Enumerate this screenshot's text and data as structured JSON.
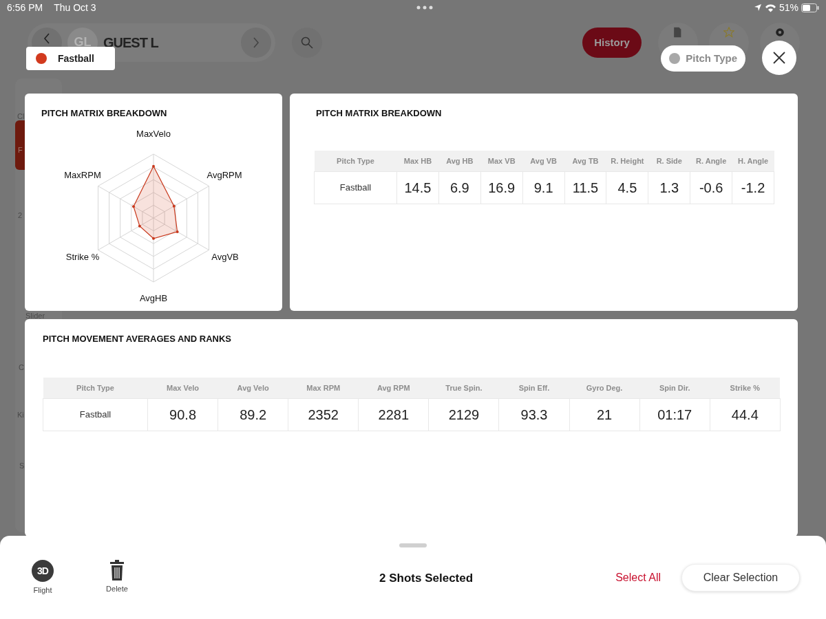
{
  "status_bar": {
    "time": "6:56 PM",
    "date": "Thu Oct 3",
    "battery": "51%"
  },
  "header": {
    "avatar": "GL",
    "player": "GUEST L",
    "history_button": "History"
  },
  "sidebar": {
    "items": [
      {
        "label": "Cl",
        "selected": false
      },
      {
        "label": "F",
        "selected": true
      },
      {
        "label": "2",
        "selected": false
      },
      {
        "label": "Slider",
        "selected": false
      },
      {
        "label": "C",
        "selected": false
      },
      {
        "label": "Ki",
        "selected": false
      },
      {
        "label": "S",
        "selected": false
      }
    ]
  },
  "filter_chip": {
    "label": "Fastball",
    "color": "#d23a1e"
  },
  "pitch_type_chip": {
    "label": "Pitch Type",
    "color": "#a8a8a8"
  },
  "radar": {
    "title": "PITCH MATRIX BREAKDOWN",
    "axes": [
      "MaxVelo",
      "AvgRPM",
      "AvgVB",
      "AvgHB",
      "Strike %",
      "MaxRPM"
    ]
  },
  "matrix_table": {
    "title": "PITCH MATRIX BREAKDOWN",
    "columns": [
      "Pitch Type",
      "Max HB",
      "Avg HB",
      "Max VB",
      "Avg VB",
      "Avg TB",
      "R. Height",
      "R. Side",
      "R. Angle",
      "H. Angle"
    ],
    "rows": [
      [
        "Fastball",
        "14.5",
        "6.9",
        "16.9",
        "9.1",
        "11.5",
        "4.5",
        "1.3",
        "-0.6",
        "-1.2"
      ]
    ]
  },
  "movement_table": {
    "title": "PITCH MOVEMENT AVERAGES AND RANKS",
    "columns": [
      "Pitch Type",
      "Max Velo",
      "Avg Velo",
      "Max RPM",
      "Avg RPM",
      "True Spin.",
      "Spin Eff.",
      "Gyro Deg.",
      "Spin Dir.",
      "Strike %"
    ],
    "rows": [
      [
        "Fastball",
        "90.8",
        "89.2",
        "2352",
        "2281",
        "2129",
        "93.3",
        "21",
        "01:17",
        "44.4"
      ]
    ]
  },
  "bottom_sheet": {
    "actions": [
      {
        "kind": "flight",
        "icon_text": "3D",
        "label": "Flight"
      },
      {
        "kind": "delete",
        "label": "Delete"
      }
    ],
    "selection_text": "2 Shots Selected",
    "select_all": "Select All",
    "clear_button": "Clear Selection"
  }
}
